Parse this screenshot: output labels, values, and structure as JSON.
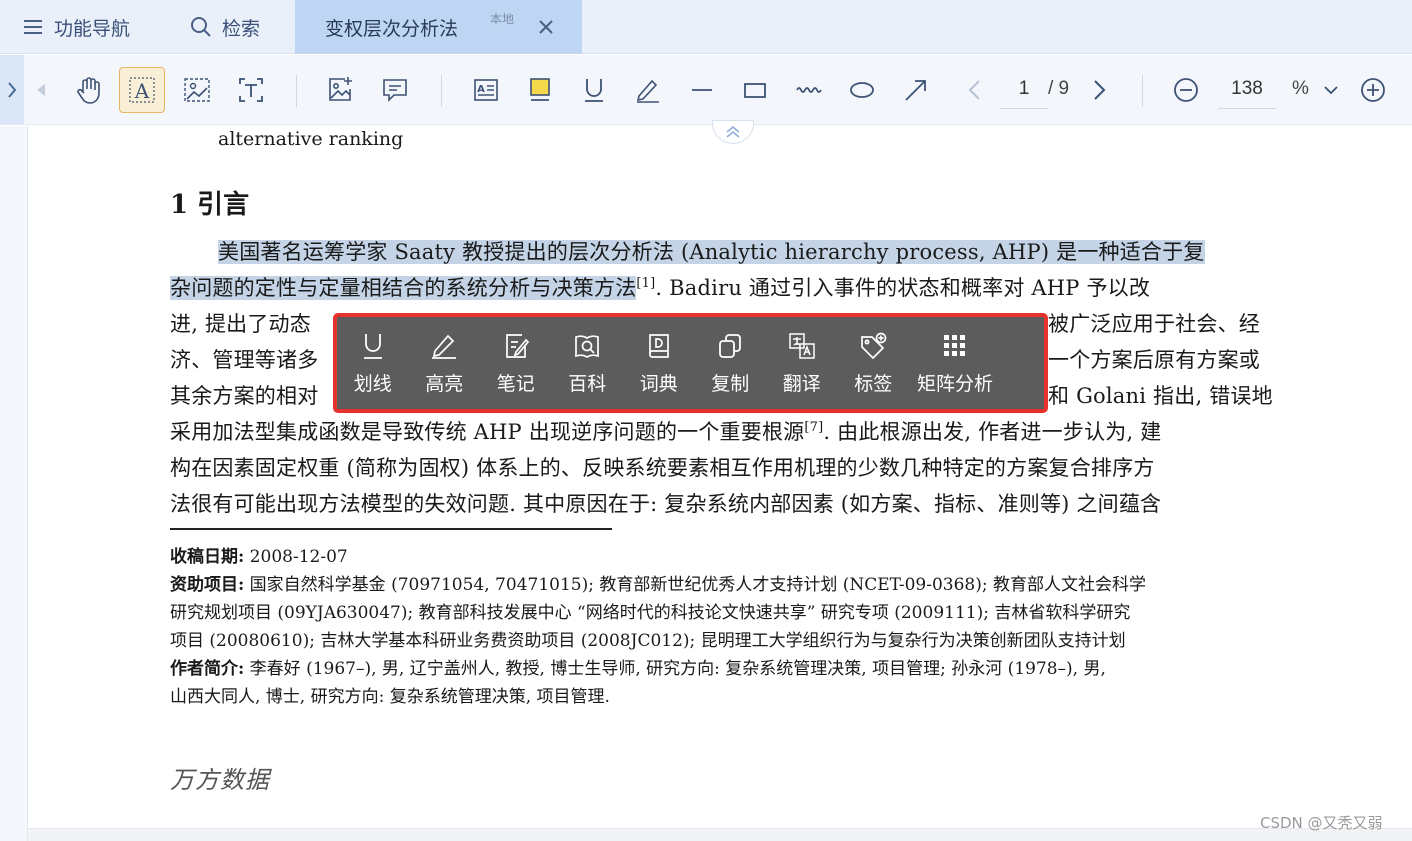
{
  "tabs": {
    "nav_label": "功能导航",
    "search_label": "检索",
    "doc_title": "变权层次分析法",
    "doc_badge": "本地"
  },
  "toolbar": {
    "current_page": "1",
    "total_pages": "/ 9",
    "zoom_value": "138",
    "zoom_unit": "%"
  },
  "document": {
    "top_line": "alternative ranking",
    "section_title": "1  引言",
    "para_lines": [
      "美国著名运筹学家 Saaty 教授提出的层次分析法 (Analytic hierarchy process, AHP) 是一种适合于复",
      "杂问题的定性与定量相结合的系统分析与决策方法",
      "[1]",
      ". Badiru 通过引入事件的状态和概率对 AHP 予以改",
      "进, 提出了动态",
      "被广泛应用于社会、经",
      "济、管理等诸多",
      "一个方案后原有方案或",
      "其余方案的相对",
      "和 Golani 指出, 错误地",
      "采用加法型集成函数是导致传统 AHP 出现逆序问题的一个重要根源",
      "[7]",
      ". 由此根源出发, 作者进一步认为, 建",
      "构在因素固定权重 (简称为固权) 体系上的、反映系统要素相互作用机理的少数几种特定的方案复合排序方",
      "法很有可能出现方法模型的失效问题. 其中原因在于: 复杂系统内部因素 (如方案、指标、准则等) 之间蕴含"
    ],
    "footnotes": {
      "received_label": "收稿日期:",
      "received_value": " 2008-12-07",
      "fund_label": "资助项目:",
      "fund_line1": " 国家自然科学基金 (70971054, 70471015); 教育部新世纪优秀人才支持计划 (NCET-09-0368); 教育部人文社会科学",
      "fund_line2": "研究规划项目 (09YJA630047); 教育部科技发展中心 “网络时代的科技论文快速共享” 研究专项 (2009111); 吉林省软科学研究",
      "fund_line3": "项目 (20080610); 吉林大学基本科研业务费资助项目 (2008JC012); 昆明理工大学组织行为与复杂行为决策创新团队支持计划",
      "author_label": "作者简介:",
      "author_line1": " 李春好 (1967–), 男, 辽宁盖州人, 教授, 博士生导师, 研究方向: 复杂系统管理决策, 项目管理; 孙永河 (1978–), 男,",
      "author_line2": "山西大同人, 博士, 研究方向: 复杂系统管理决策, 项目管理."
    },
    "logo_text": "万方数据"
  },
  "popup_menu": {
    "items": [
      {
        "label": "划线",
        "icon": "underline-icon"
      },
      {
        "label": "高亮",
        "icon": "highlight-pen-icon"
      },
      {
        "label": "笔记",
        "icon": "note-icon"
      },
      {
        "label": "百科",
        "icon": "encyclopedia-icon"
      },
      {
        "label": "词典",
        "icon": "dictionary-icon"
      },
      {
        "label": "复制",
        "icon": "copy-icon"
      },
      {
        "label": "翻译",
        "icon": "translate-icon"
      },
      {
        "label": "标签",
        "icon": "tag-icon"
      },
      {
        "label": "矩阵分析",
        "icon": "matrix-grid-icon"
      }
    ],
    "border_color": "#e5322d"
  },
  "watermark": "CSDN @又秃又弱"
}
